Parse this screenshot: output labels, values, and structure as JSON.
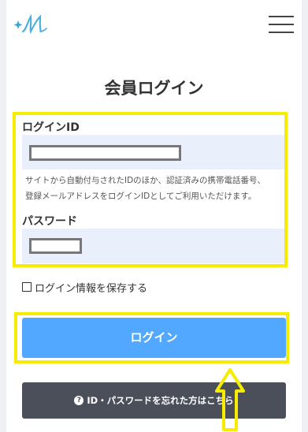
{
  "header": {
    "logo_icon": "sparkle-m-logo",
    "menu_icon": "hamburger-menu-icon"
  },
  "page_title": "会員ログイン",
  "form": {
    "login_id_label": "ログインID",
    "login_id_value": "",
    "help_text_line1": "サイトから自動付与されたIDのほか、認証済みの携帯電話番号、",
    "help_text_line2": "登録メールアドレスをログインIDとしてご利用いただけます。",
    "password_label": "パスワード",
    "password_value": ""
  },
  "remember": {
    "label": "ログイン情報を保存する",
    "checked": false
  },
  "login_button": "ログイン",
  "forgot_button": "ID・パスワードを忘れた方はこちら",
  "colors": {
    "highlight": "#f6ec00",
    "login_button_bg": "#52a8ff",
    "forgot_button_bg": "#4a4f5a",
    "field_bg": "#e9f0fb"
  }
}
